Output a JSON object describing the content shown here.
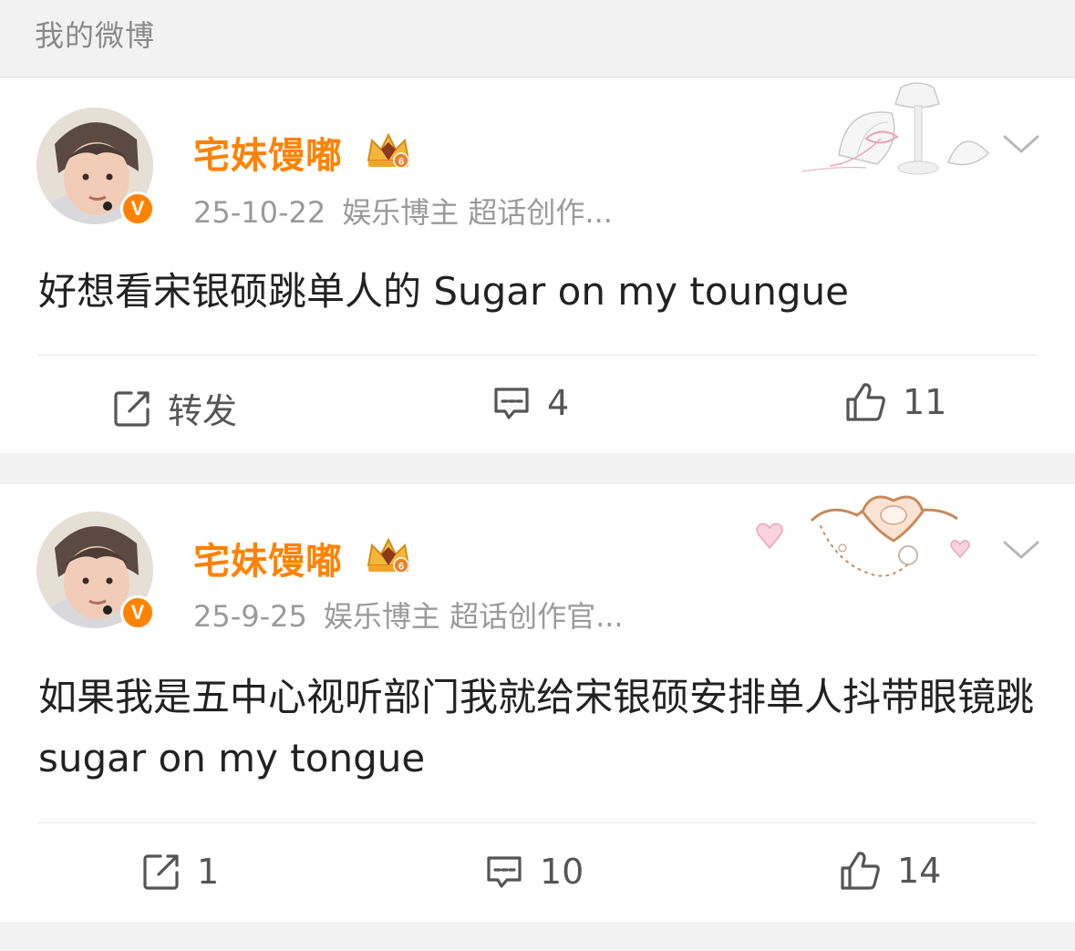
{
  "section": {
    "title": "我的微博"
  },
  "posts": [
    {
      "username": "宅妹馒嘟",
      "date": "25-10-22",
      "tags": "娱乐博主 超话创作...",
      "text": "好想看宋银硕跳单人的 Sugar on my toungue",
      "actions": {
        "repost": "转发",
        "comments": "4",
        "likes": "11"
      }
    },
    {
      "username": "宅妹馒嘟",
      "date": "25-9-25",
      "tags": "娱乐博主 超话创作官...",
      "text": "如果我是五中心视听部门我就给宋银硕安排单人抖带眼镜跳 sugar on my tongue",
      "actions": {
        "repost": "1",
        "comments": "10",
        "likes": "14"
      }
    }
  ],
  "icons": {
    "repost": "repost-icon",
    "comment": "comment-icon",
    "like": "like-icon",
    "more": "chevron-down-icon",
    "verified": "verified-v-icon",
    "vip": "crown-level-icon"
  },
  "colors": {
    "accent": "#ff8200",
    "text": "#222222",
    "muted": "#9a9a9a"
  }
}
